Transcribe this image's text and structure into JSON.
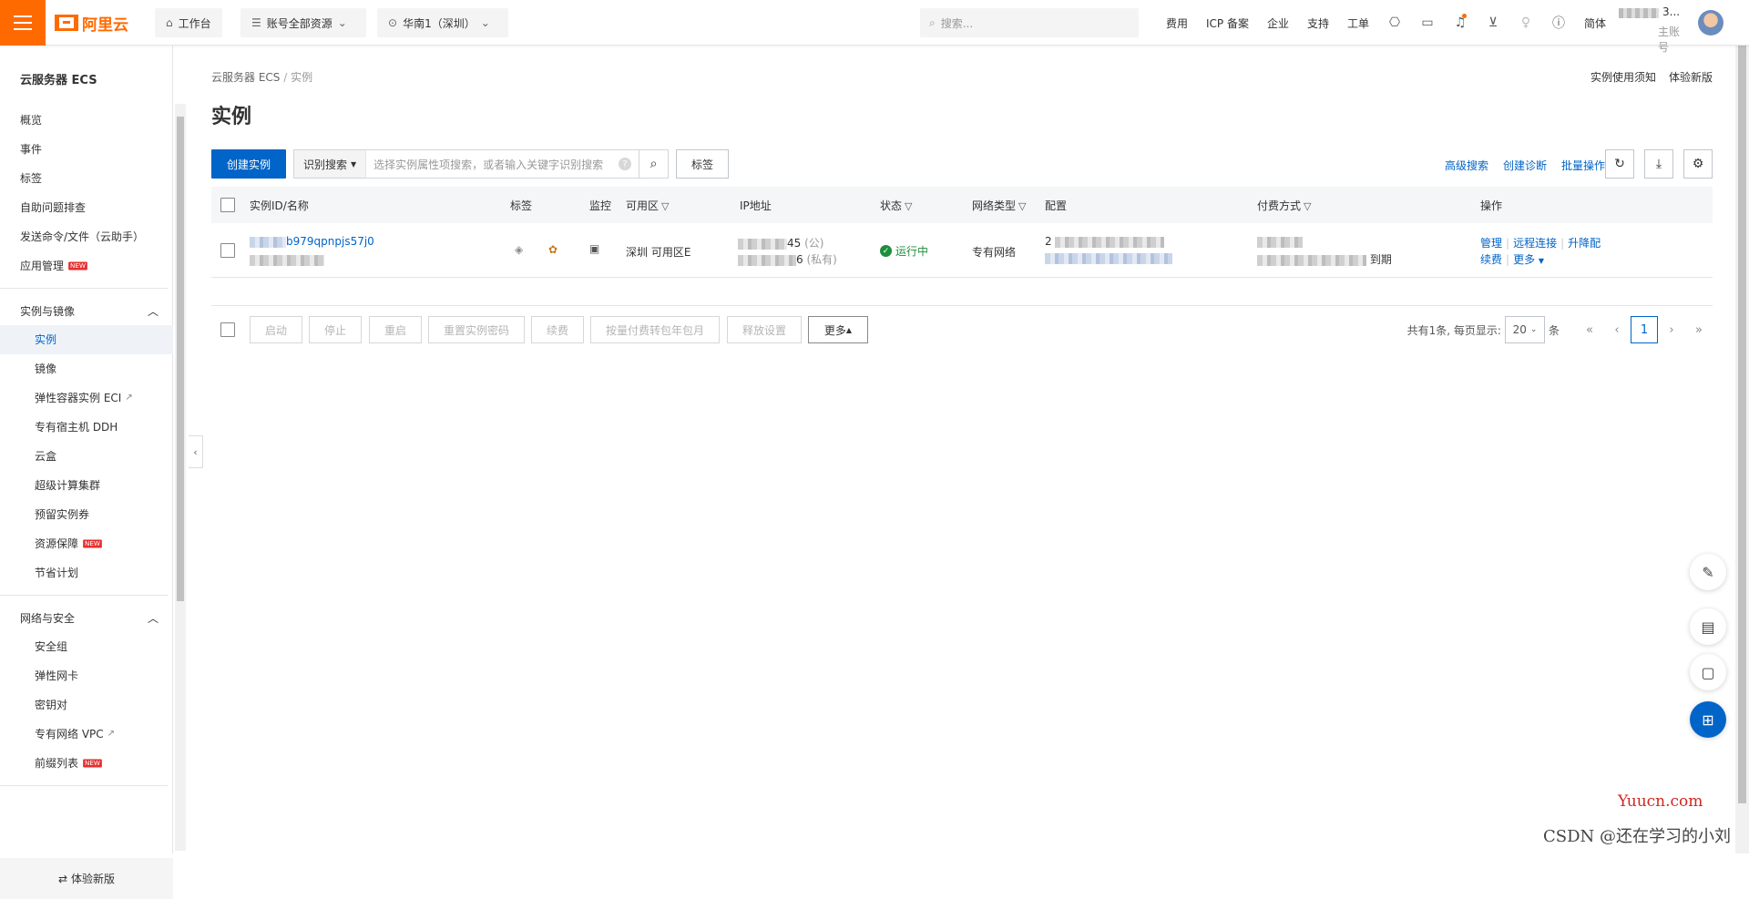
{
  "header": {
    "logo_text": "阿里云",
    "workbench": "工作台",
    "resources": "账号全部资源",
    "region": "华南1（深圳）",
    "search_placeholder": "搜索...",
    "links": [
      "费用",
      "ICP 备案",
      "企业",
      "支持",
      "工单"
    ],
    "lang": "简体",
    "account_num": "3...",
    "account_role": "主账号"
  },
  "sidebar": {
    "title": "云服务器 ECS",
    "top_items": [
      "概览",
      "事件",
      "标签",
      "自助问题排查",
      "发送命令/文件（云助手）",
      "应用管理"
    ],
    "groups": [
      {
        "label": "实例与镜像",
        "items": [
          "实例",
          "镜像",
          "弹性容器实例 ECI",
          "专有宿主机 DDH",
          "云盒",
          "超级计算集群",
          "预留实例券",
          "资源保障",
          "节省计划"
        ]
      },
      {
        "label": "网络与安全",
        "items": [
          "安全组",
          "弹性网卡",
          "密钥对",
          "专有网络 VPC",
          "前缀列表"
        ]
      }
    ],
    "new_badge": "NEW",
    "footer": "体验新版"
  },
  "main": {
    "breadcrumb_root": "云服务器 ECS",
    "breadcrumb_sep": "/",
    "breadcrumb_current": "实例",
    "top_right_links": [
      "实例使用须知",
      "体验新版"
    ],
    "title": "实例",
    "create_button": "创建实例",
    "search_mode": "识别搜索",
    "search_placeholder": "选择实例属性项搜索，或者输入关键字识别搜索",
    "tag_button": "标签",
    "toolbar_links": [
      "高级搜索",
      "创建诊断",
      "批量操作"
    ]
  },
  "table": {
    "columns": [
      "实例ID/名称",
      "标签",
      "监控",
      "可用区",
      "IP地址",
      "状态",
      "网络类型",
      "配置",
      "付费方式",
      "操作"
    ],
    "rows": [
      {
        "instance_id_suffix": "b979qpnpjs57j0",
        "zone": "深圳 可用区E",
        "ip_public_suffix": "45",
        "ip_public_tag": "(公)",
        "ip_private_suffix": "6",
        "ip_private_tag": "(私有)",
        "status": "运行中",
        "network": "专有网络",
        "config_prefix": "2",
        "pay_suffix": "到期",
        "actions": [
          "管理",
          "远程连接",
          "升降配",
          "续费",
          "更多"
        ]
      }
    ]
  },
  "bottom": {
    "actions": [
      "启动",
      "停止",
      "重启",
      "重置实例密码",
      "续费",
      "按量付费转包年包月",
      "释放设置"
    ],
    "more": "更多",
    "total_text": "共有1条, 每页显示:",
    "page_size": "20",
    "unit": "条",
    "current_page": "1"
  },
  "watermark": {
    "line1": "Yuucn.com",
    "line2": "CSDN @还在学习的小刘"
  }
}
